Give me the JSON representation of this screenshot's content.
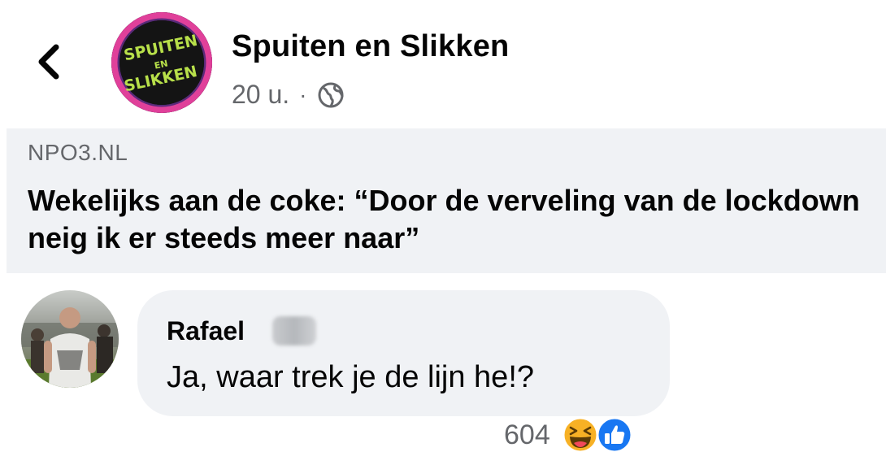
{
  "header": {
    "back_icon": "chevron-left-icon",
    "page_name": "Spuiten en Slikken",
    "logo_text": "SPUITEN EN SLIKKEN",
    "time": "20 u.",
    "separator": "·",
    "privacy_icon": "globe-icon"
  },
  "link_preview": {
    "domain": "NPO3.NL",
    "title": "Wekelijks aan de coke: “Door de verveling van de lockdown neig ik er steeds meer naar”"
  },
  "comment": {
    "author": "Rafael",
    "text": "Ja, waar trek je de lijn he!?",
    "reactions": {
      "count": "604",
      "icons": [
        "haha-icon",
        "like-icon"
      ]
    }
  },
  "colors": {
    "secondary_text": "#65676b",
    "bubble_bg": "#f0f2f5",
    "like_blue": "#1877f2",
    "haha_yellow": "#f7b125"
  }
}
